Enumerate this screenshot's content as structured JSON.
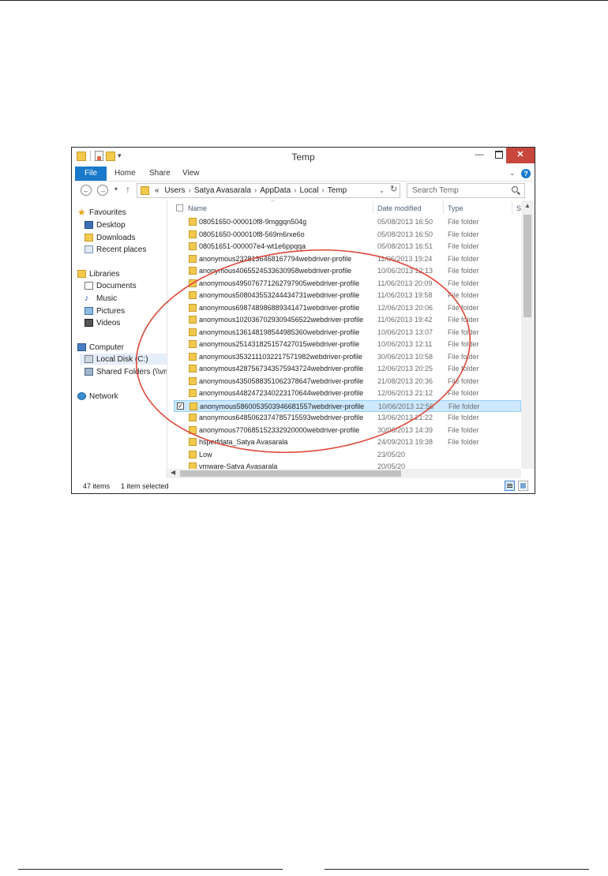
{
  "window": {
    "title": "Temp",
    "controls": {
      "minimize": "—",
      "close": "✕"
    }
  },
  "ribbon": {
    "tabs": [
      "File",
      "Home",
      "Share",
      "View"
    ],
    "help": "?"
  },
  "address_bar": {
    "prefix": "«",
    "path": [
      "Users",
      "Satya Avasarala",
      "AppData",
      "Local",
      "Temp"
    ],
    "search_placeholder": "Search Temp"
  },
  "nav_pane": {
    "favourites": {
      "label": "Favourites",
      "items": [
        "Desktop",
        "Downloads",
        "Recent places"
      ]
    },
    "libraries": {
      "label": "Libraries",
      "items": [
        "Documents",
        "Music",
        "Pictures",
        "Videos"
      ]
    },
    "computer": {
      "label": "Computer",
      "items": [
        "Local Disk (C:)",
        "Shared Folders (\\\\vm"
      ]
    },
    "network": {
      "label": "Network"
    },
    "selected": "Local Disk (C:)"
  },
  "columns": {
    "name": "Name",
    "date": "Date modified",
    "type": "Type",
    "size": "Si"
  },
  "files": [
    {
      "name": "08051650-000010f8-9mggqn504g",
      "date": "05/08/2013 16:50",
      "type": "File folder"
    },
    {
      "name": "08051650-000010f8-569m6rxe6o",
      "date": "05/08/2013 16:50",
      "type": "File folder"
    },
    {
      "name": "08051651-000007e4-wt1e6ppqqa",
      "date": "05/08/2013 16:51",
      "type": "File folder"
    },
    {
      "name": "anonymous2328136468167794webdriver-profile",
      "date": "11/06/2013 19:24",
      "type": "File folder"
    },
    {
      "name": "anonymous4065524533630958webdriver-profile",
      "date": "10/06/2013 12:13",
      "type": "File folder"
    },
    {
      "name": "anonymous4950767712627979​05webdriver-profile",
      "date": "11/06/2013 20:09",
      "type": "File folder"
    },
    {
      "name": "anonymous5080435532444347​31webdriver-profile",
      "date": "11/06/2013 19:58",
      "type": "File folder"
    },
    {
      "name": "anonymous6987489868893414​71webdriver-profile",
      "date": "12/06/2013 20:06",
      "type": "File folder"
    },
    {
      "name": "anonymous1020367029309456522webdriver-profile",
      "date": "11/06/2013 19:42",
      "type": "File folder"
    },
    {
      "name": "anonymous1361481985449853​60webdriver-profile",
      "date": "10/06/2013 13:07",
      "type": "File folder"
    },
    {
      "name": "anonymous2514318251574270​15webdriver-profile",
      "date": "10/06/2013 12:11",
      "type": "File folder"
    },
    {
      "name": "anonymous3532111032217571982webdriver-profile",
      "date": "30/06/2013 10:58",
      "type": "File folder"
    },
    {
      "name": "anonymous4287567343575943724webdriver-profile",
      "date": "12/06/2013 20:25",
      "type": "File folder"
    },
    {
      "name": "anonymous4350588351062378647webdriver-profile",
      "date": "21/08/2013 20:36",
      "type": "File folder"
    },
    {
      "name": "anonymous4482472340223170644webdriver-profile",
      "date": "12/06/2013 21:12",
      "type": "File folder"
    },
    {
      "name": "anonymous5860053503946681557webdriver-profile",
      "date": "10/06/2013 12:56",
      "type": "File folder",
      "selected": true
    },
    {
      "name": "anonymous6485062374785715593webdriver-profile",
      "date": "13/06/2013 21:22",
      "type": "File folder"
    },
    {
      "name": "anonymous7706851523329200​00webdriver-profile",
      "date": "30/06/2013 14:39",
      "type": "File folder"
    },
    {
      "name": "hsperfdata_Satya Avasarala",
      "date": "24/09/2013 19:38",
      "type": "File folder"
    },
    {
      "name": "Low",
      "date": "23/05/20",
      "type": ""
    },
    {
      "name": "vmware-Satya Avasarala",
      "date": "20/05/20",
      "type": ""
    }
  ],
  "status": {
    "count": "47 items",
    "selection": "1 item selected"
  },
  "colors": {
    "accent": "#1979ca",
    "close": "#c9463d",
    "annotation": "#e0483a"
  }
}
